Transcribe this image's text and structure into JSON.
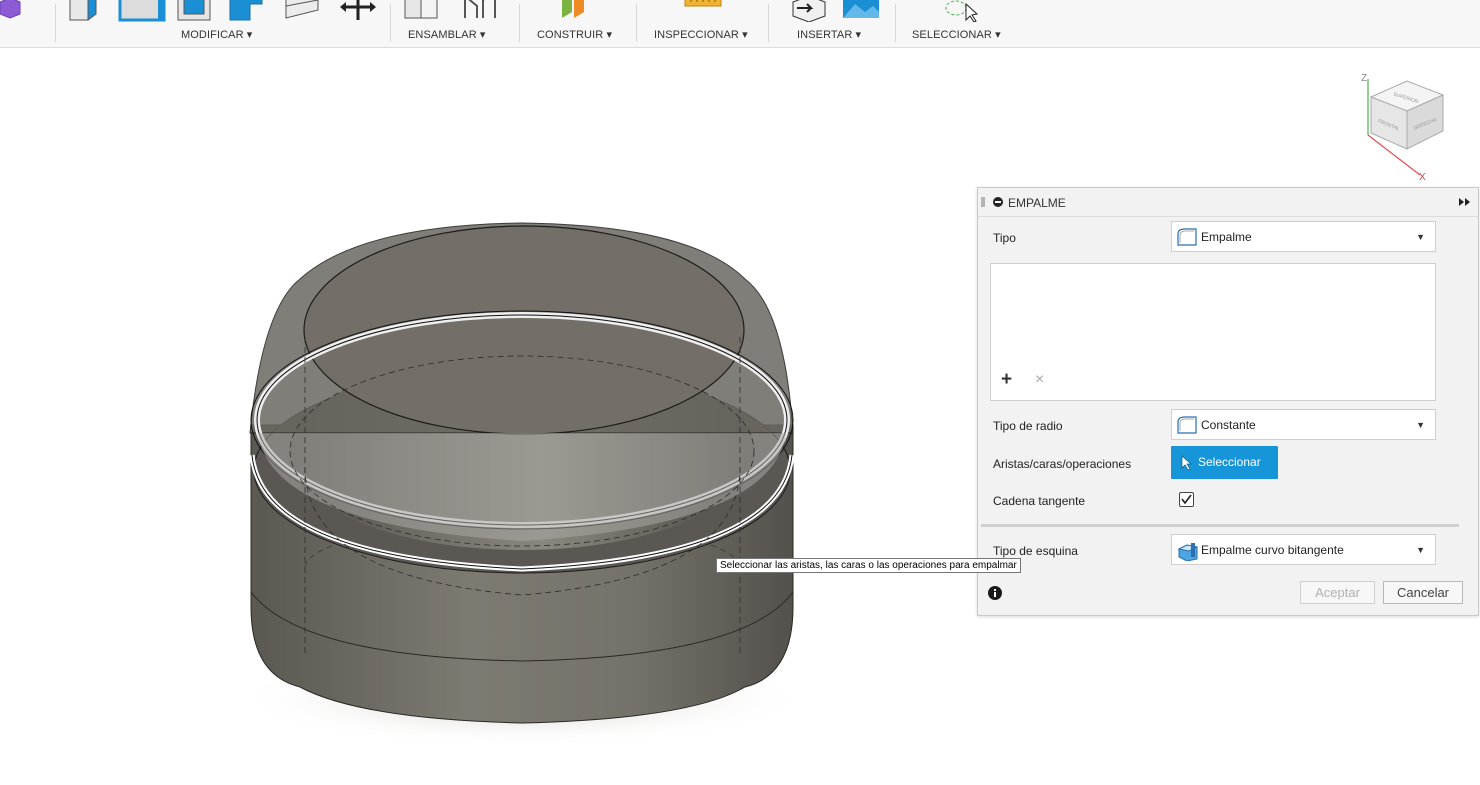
{
  "toolbar": {
    "groups": [
      {
        "label": "MODIFICAR ▾"
      },
      {
        "label": "ENSAMBLAR ▾"
      },
      {
        "label": "CONSTRUIR ▾"
      },
      {
        "label": "INSPECCIONAR ▾"
      },
      {
        "label": "INSERTAR ▾"
      },
      {
        "label": "SELECCIONAR ▾"
      }
    ]
  },
  "viewcube": {
    "axis_z": "Z",
    "axis_x": "X",
    "face_top": "SUPERIOR",
    "face_front": "FRONTAL",
    "face_right": "DERECHA"
  },
  "panel": {
    "title": "EMPALME",
    "type_label": "Tipo",
    "type_value": "Empalme",
    "add_symbol": "+",
    "remove_symbol": "×",
    "radius_type_label": "Tipo de radio",
    "radius_type_value": "Constante",
    "edges_label": "Aristas/caras/operaciones",
    "select_button": "Seleccionar",
    "tangent_chain_label": "Cadena tangente",
    "tangent_chain_checked": true,
    "corner_type_label": "Tipo de esquina",
    "corner_type_value": "Empalme curvo bitangente",
    "ok_button": "Aceptar",
    "cancel_button": "Cancelar"
  },
  "tooltip": {
    "text": "Seleccionar las aristas, las caras o las operaciones para empalmar"
  },
  "colors": {
    "accent": "#1696d8",
    "body": "#6e6a63",
    "highlight_edge": "#000000"
  }
}
